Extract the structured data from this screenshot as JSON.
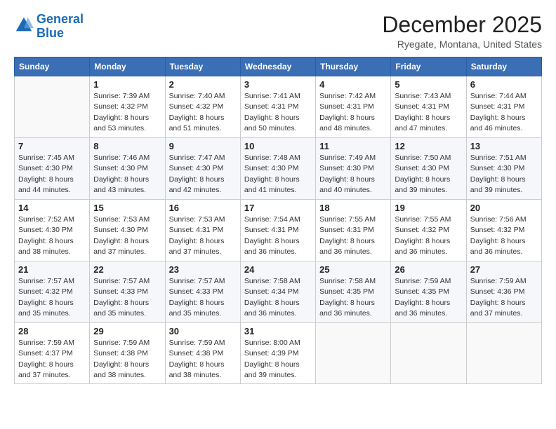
{
  "logo": {
    "line1": "General",
    "line2": "Blue"
  },
  "title": "December 2025",
  "location": "Ryegate, Montana, United States",
  "header_days": [
    "Sunday",
    "Monday",
    "Tuesday",
    "Wednesday",
    "Thursday",
    "Friday",
    "Saturday"
  ],
  "weeks": [
    [
      {
        "day": "",
        "info": ""
      },
      {
        "day": "1",
        "info": "Sunrise: 7:39 AM\nSunset: 4:32 PM\nDaylight: 8 hours\nand 53 minutes."
      },
      {
        "day": "2",
        "info": "Sunrise: 7:40 AM\nSunset: 4:32 PM\nDaylight: 8 hours\nand 51 minutes."
      },
      {
        "day": "3",
        "info": "Sunrise: 7:41 AM\nSunset: 4:31 PM\nDaylight: 8 hours\nand 50 minutes."
      },
      {
        "day": "4",
        "info": "Sunrise: 7:42 AM\nSunset: 4:31 PM\nDaylight: 8 hours\nand 48 minutes."
      },
      {
        "day": "5",
        "info": "Sunrise: 7:43 AM\nSunset: 4:31 PM\nDaylight: 8 hours\nand 47 minutes."
      },
      {
        "day": "6",
        "info": "Sunrise: 7:44 AM\nSunset: 4:31 PM\nDaylight: 8 hours\nand 46 minutes."
      }
    ],
    [
      {
        "day": "7",
        "info": "Sunrise: 7:45 AM\nSunset: 4:30 PM\nDaylight: 8 hours\nand 44 minutes."
      },
      {
        "day": "8",
        "info": "Sunrise: 7:46 AM\nSunset: 4:30 PM\nDaylight: 8 hours\nand 43 minutes."
      },
      {
        "day": "9",
        "info": "Sunrise: 7:47 AM\nSunset: 4:30 PM\nDaylight: 8 hours\nand 42 minutes."
      },
      {
        "day": "10",
        "info": "Sunrise: 7:48 AM\nSunset: 4:30 PM\nDaylight: 8 hours\nand 41 minutes."
      },
      {
        "day": "11",
        "info": "Sunrise: 7:49 AM\nSunset: 4:30 PM\nDaylight: 8 hours\nand 40 minutes."
      },
      {
        "day": "12",
        "info": "Sunrise: 7:50 AM\nSunset: 4:30 PM\nDaylight: 8 hours\nand 39 minutes."
      },
      {
        "day": "13",
        "info": "Sunrise: 7:51 AM\nSunset: 4:30 PM\nDaylight: 8 hours\nand 39 minutes."
      }
    ],
    [
      {
        "day": "14",
        "info": "Sunrise: 7:52 AM\nSunset: 4:30 PM\nDaylight: 8 hours\nand 38 minutes."
      },
      {
        "day": "15",
        "info": "Sunrise: 7:53 AM\nSunset: 4:30 PM\nDaylight: 8 hours\nand 37 minutes."
      },
      {
        "day": "16",
        "info": "Sunrise: 7:53 AM\nSunset: 4:31 PM\nDaylight: 8 hours\nand 37 minutes."
      },
      {
        "day": "17",
        "info": "Sunrise: 7:54 AM\nSunset: 4:31 PM\nDaylight: 8 hours\nand 36 minutes."
      },
      {
        "day": "18",
        "info": "Sunrise: 7:55 AM\nSunset: 4:31 PM\nDaylight: 8 hours\nand 36 minutes."
      },
      {
        "day": "19",
        "info": "Sunrise: 7:55 AM\nSunset: 4:32 PM\nDaylight: 8 hours\nand 36 minutes."
      },
      {
        "day": "20",
        "info": "Sunrise: 7:56 AM\nSunset: 4:32 PM\nDaylight: 8 hours\nand 36 minutes."
      }
    ],
    [
      {
        "day": "21",
        "info": "Sunrise: 7:57 AM\nSunset: 4:32 PM\nDaylight: 8 hours\nand 35 minutes."
      },
      {
        "day": "22",
        "info": "Sunrise: 7:57 AM\nSunset: 4:33 PM\nDaylight: 8 hours\nand 35 minutes."
      },
      {
        "day": "23",
        "info": "Sunrise: 7:57 AM\nSunset: 4:33 PM\nDaylight: 8 hours\nand 35 minutes."
      },
      {
        "day": "24",
        "info": "Sunrise: 7:58 AM\nSunset: 4:34 PM\nDaylight: 8 hours\nand 36 minutes."
      },
      {
        "day": "25",
        "info": "Sunrise: 7:58 AM\nSunset: 4:35 PM\nDaylight: 8 hours\nand 36 minutes."
      },
      {
        "day": "26",
        "info": "Sunrise: 7:59 AM\nSunset: 4:35 PM\nDaylight: 8 hours\nand 36 minutes."
      },
      {
        "day": "27",
        "info": "Sunrise: 7:59 AM\nSunset: 4:36 PM\nDaylight: 8 hours\nand 37 minutes."
      }
    ],
    [
      {
        "day": "28",
        "info": "Sunrise: 7:59 AM\nSunset: 4:37 PM\nDaylight: 8 hours\nand 37 minutes."
      },
      {
        "day": "29",
        "info": "Sunrise: 7:59 AM\nSunset: 4:38 PM\nDaylight: 8 hours\nand 38 minutes."
      },
      {
        "day": "30",
        "info": "Sunrise: 7:59 AM\nSunset: 4:38 PM\nDaylight: 8 hours\nand 38 minutes."
      },
      {
        "day": "31",
        "info": "Sunrise: 8:00 AM\nSunset: 4:39 PM\nDaylight: 8 hours\nand 39 minutes."
      },
      {
        "day": "",
        "info": ""
      },
      {
        "day": "",
        "info": ""
      },
      {
        "day": "",
        "info": ""
      }
    ]
  ]
}
